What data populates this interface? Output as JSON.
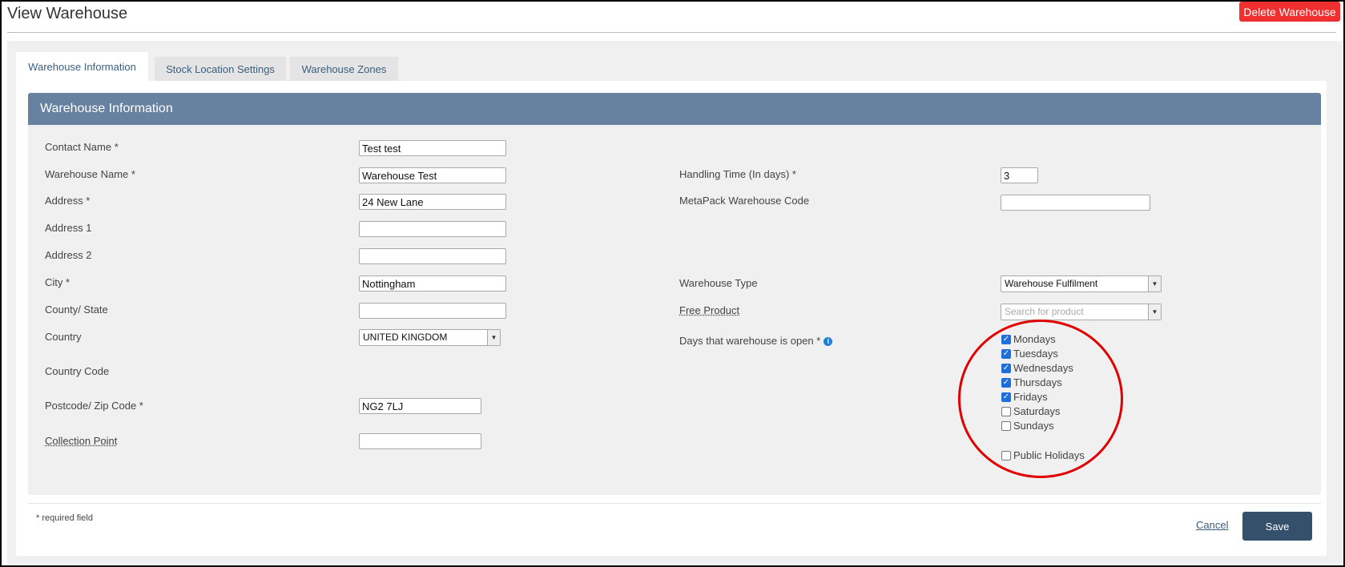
{
  "header": {
    "title": "View Warehouse",
    "delete_label": "Delete Warehouse"
  },
  "tabs": [
    {
      "label": "Warehouse Information"
    },
    {
      "label": "Stock Location Settings"
    },
    {
      "label": "Warehouse Zones"
    }
  ],
  "section": {
    "title": "Warehouse Information"
  },
  "fields": {
    "contact_name": {
      "label": "Contact Name *",
      "value": "Test test"
    },
    "warehouse_name": {
      "label": "Warehouse Name *",
      "value": "Warehouse Test"
    },
    "address": {
      "label": "Address *",
      "value": "24 New Lane"
    },
    "address1": {
      "label": "Address 1",
      "value": ""
    },
    "address2": {
      "label": "Address 2",
      "value": ""
    },
    "city": {
      "label": "City *",
      "value": "Nottingham"
    },
    "county": {
      "label": "County/ State",
      "value": ""
    },
    "country": {
      "label": "Country",
      "value": "UNITED KINGDOM"
    },
    "country_code": {
      "label": "Country Code"
    },
    "postcode": {
      "label": "Postcode/ Zip Code *",
      "value": "NG2 7LJ"
    },
    "collection_point": {
      "label": "Collection Point",
      "value": ""
    },
    "handling_time": {
      "label": "Handling Time (In days) *",
      "value": "3"
    },
    "metapack_code": {
      "label": "MetaPack Warehouse Code",
      "value": ""
    },
    "warehouse_type": {
      "label": "Warehouse Type",
      "value": "Warehouse Fulfilment"
    },
    "free_product": {
      "label": "Free Product",
      "placeholder": "Search for product"
    },
    "days_open": {
      "label": "Days that warehouse is open *"
    }
  },
  "days": [
    {
      "label": "Mondays",
      "checked": true
    },
    {
      "label": "Tuesdays",
      "checked": true
    },
    {
      "label": "Wednesdays",
      "checked": true
    },
    {
      "label": "Thursdays",
      "checked": true
    },
    {
      "label": "Fridays",
      "checked": true
    },
    {
      "label": "Saturdays",
      "checked": false
    },
    {
      "label": "Sundays",
      "checked": false
    }
  ],
  "public_holidays": {
    "label": "Public Holidays",
    "checked": false
  },
  "footer": {
    "required_note": "* required field",
    "cancel_label": "Cancel",
    "save_label": "Save"
  },
  "colors": {
    "header_bar": "#6782a0",
    "delete_button": "#f03030",
    "save_button": "#35506b",
    "annotation_circle": "#e00000",
    "checkbox_on": "#1e6fd9"
  }
}
